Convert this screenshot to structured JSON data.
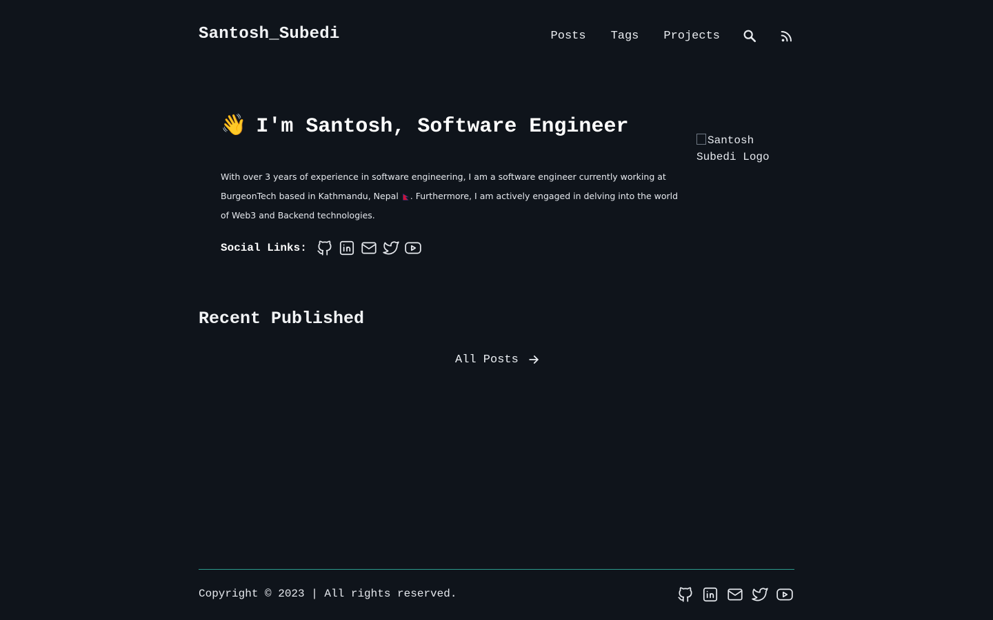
{
  "header": {
    "site_title": "Santosh_Subedi",
    "nav": [
      "Posts",
      "Tags",
      "Projects"
    ],
    "search_icon": "search-icon",
    "rss_icon": "rss-icon"
  },
  "hero": {
    "emoji": "👋",
    "title": "I'm Santosh, Software Engineer",
    "text_part1": "With over 3 years of experience in software engineering, I am a software engineer currently working at BurgeonTech based in Kathmandu, Nepal",
    "text_part2": ". Furthermore, I am actively engaged in delving into the world of Web3 and Backend technologies.",
    "flag_icon": "nepal-flag-icon",
    "logo_alt": "Santosh Subedi Logo"
  },
  "social": {
    "label": "Social Links:",
    "icons": [
      "github-icon",
      "linkedin-icon",
      "mail-icon",
      "twitter-icon",
      "youtube-icon"
    ]
  },
  "recent": {
    "title": "Recent Published",
    "all_posts": "All Posts"
  },
  "footer": {
    "copyright": "Copyright © 2023 | All rights reserved."
  },
  "colors": {
    "background": "#0f141b",
    "text": "#e9edf1",
    "accent_line": "#2c9c8e"
  }
}
